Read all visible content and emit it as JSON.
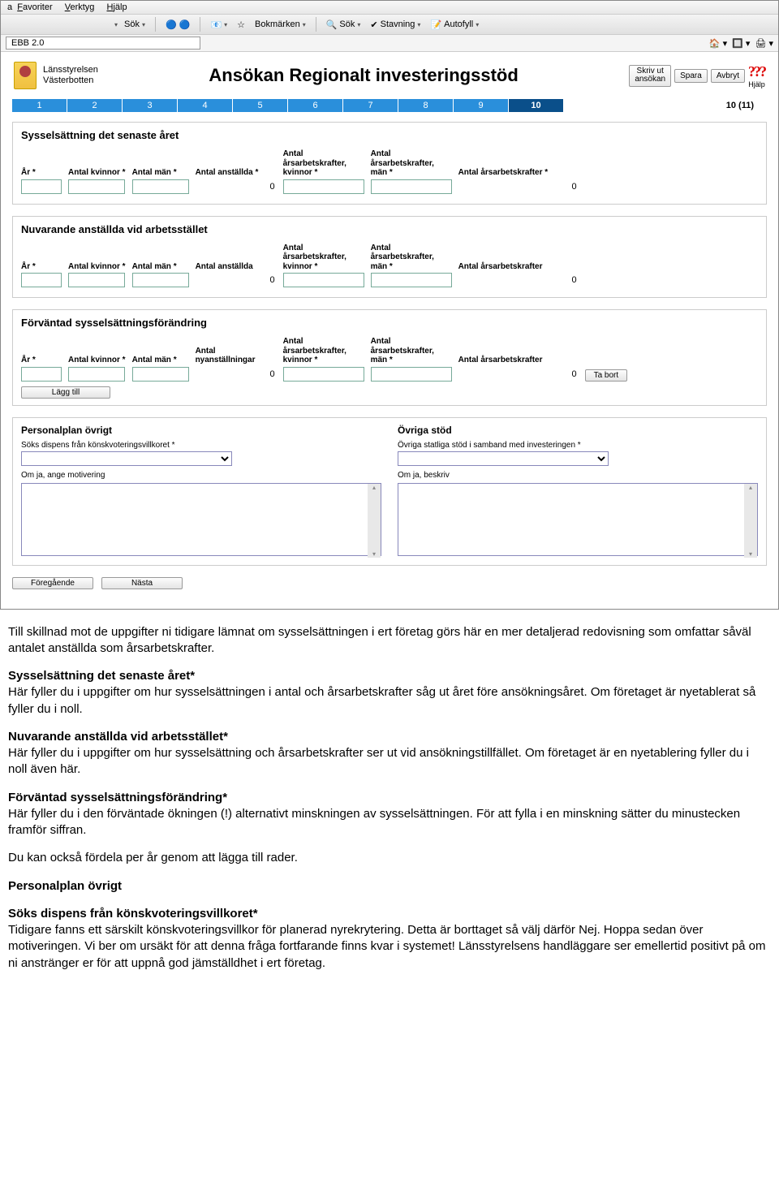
{
  "menu": {
    "favoriter": "Favoriter",
    "verktyg": "Verktyg",
    "hjalp": "Hjälp"
  },
  "toolbar": {
    "sok": "Sök",
    "bokmarken": "Bokmärken",
    "sok2": "Sök",
    "stavning": "Stavning",
    "autofyll": "Autofyll"
  },
  "url": "EBB 2.0",
  "org": {
    "line1": "Länsstyrelsen",
    "line2": "Västerbotten"
  },
  "title": "Ansökan Regionalt investeringsstöd",
  "head_buttons": {
    "skrivut": "Skriv ut\nansökan",
    "spara": "Spara",
    "avbryt": "Avbryt",
    "hjalp": "Hjälp"
  },
  "steps": [
    "1",
    "2",
    "3",
    "4",
    "5",
    "6",
    "7",
    "8",
    "9",
    "10"
  ],
  "step_active": 10,
  "step_counter": "10 (11)",
  "cols": {
    "ar": "År *",
    "kvinnor": "Antal kvinnor *",
    "man": "Antal män *",
    "anstallda": "Antal anställda",
    "anstallda_star": "Antal anställda *",
    "nyanst": "Antal\nnyanställningar",
    "ars_k": "Antal\nårsarbetskrafter,\nkvinnor *",
    "ars_m": "Antal\nårsarbetskrafter,\nmän *",
    "ars_tot": "Antal årsarbetskrafter",
    "ars_tot_star": "Antal årsarbetskrafter *"
  },
  "zero": "0",
  "sec1": {
    "title": "Sysselsättning det senaste året"
  },
  "sec2": {
    "title": "Nuvarande anställda vid arbetsstället"
  },
  "sec3": {
    "title": "Förväntad sysselsättningsförändring",
    "laggtill": "Lägg till",
    "tabort": "Ta bort"
  },
  "sec4": {
    "left_title": "Personalplan övrigt",
    "left_q": "Söks dispens från könskvoteringsvillkoret *",
    "left_follow": "Om ja, ange motivering",
    "right_title": "Övriga stöd",
    "right_q": "Övriga statliga stöd i samband med investeringen *",
    "right_follow": "Om ja, beskriv"
  },
  "nav": {
    "prev": "Föregående",
    "next": "Nästa"
  },
  "doc": {
    "p1": "Till skillnad mot de uppgifter ni tidigare lämnat om sysselsättningen i ert företag görs här en mer detaljerad redovisning som omfattar såväl antalet anställda som årsarbetskrafter.",
    "h1": "Sysselsättning det senaste året*",
    "p2": "Här fyller du i uppgifter om hur sysselsättningen i antal och årsarbetskrafter såg ut året före ansökningsåret. Om företaget är nyetablerat så fyller du i noll.",
    "h2": "Nuvarande anställda vid arbetsstället*",
    "p3": "Här fyller du i uppgifter om hur sysselsättning och årsarbetskrafter ser ut vid ansökningstillfället. Om företaget är en nyetablering fyller du i noll även här.",
    "h3": "Förväntad sysselsättningsförändring*",
    "p4": "Här fyller du i den förväntade ökningen (!) alternativt minskningen av sysselsättningen. För att fylla i en minskning sätter du minustecken framför siffran.",
    "p5": "Du kan också fördela per år genom att lägga till rader.",
    "h4": "Personalplan övrigt",
    "h5": "Söks dispens från könskvoteringsvillkoret*",
    "p6": "Tidigare fanns ett särskilt könskvoteringsvillkor för planerad nyrekrytering. Detta är borttaget så välj därför Nej. Hoppa sedan över motiveringen. Vi ber om ursäkt för att denna fråga fortfarande finns kvar i systemet! Länsstyrelsens handläggare ser emellertid positivt på om ni anstränger er för att uppnå god jämställdhet i ert företag."
  }
}
